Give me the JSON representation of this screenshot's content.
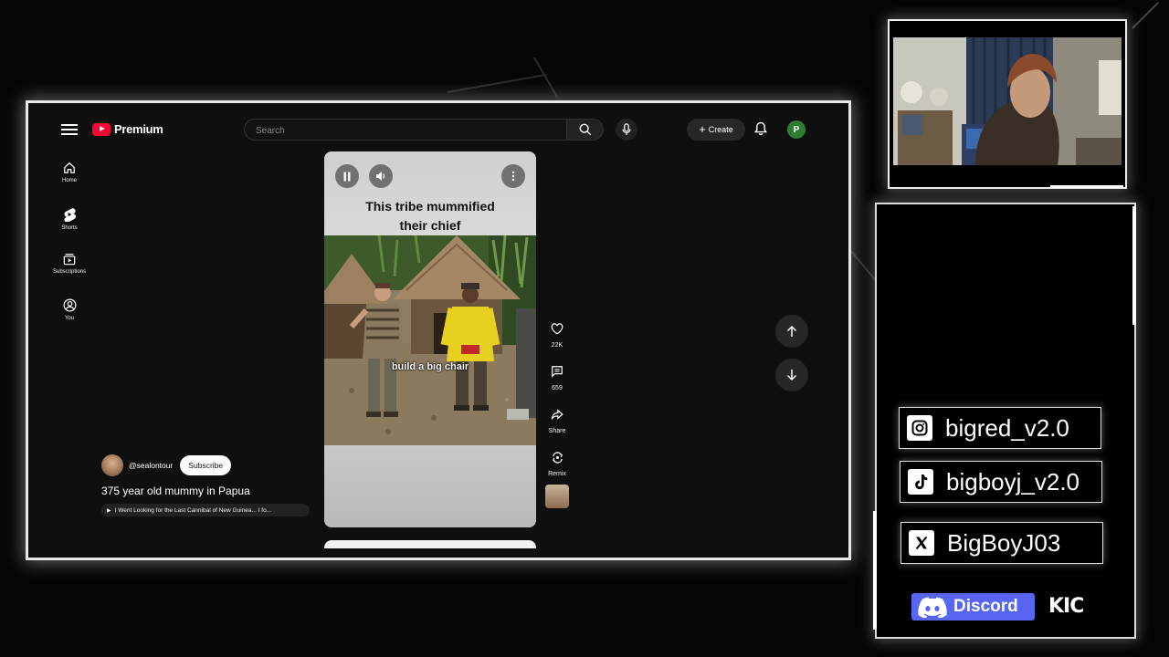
{
  "youtube": {
    "logo_text": "Premium",
    "search_placeholder": "Search",
    "create_label": "Create",
    "avatar_letter": "P",
    "nav": [
      {
        "label": "Home",
        "icon": "home-icon"
      },
      {
        "label": "Shorts",
        "icon": "shorts-icon"
      },
      {
        "label": "Subscriptions",
        "icon": "subscriptions-icon"
      },
      {
        "label": "You",
        "icon": "you-icon"
      }
    ]
  },
  "short": {
    "caption_line1": "This tribe mummified",
    "caption_line2": "their chief",
    "subtitle": "build a big chair",
    "actions": [
      {
        "label": "22K",
        "icon": "like-icon"
      },
      {
        "label": "659",
        "icon": "comment-icon"
      },
      {
        "label": "Share",
        "icon": "share-icon"
      },
      {
        "label": "Remix",
        "icon": "remix-icon"
      }
    ],
    "channel": "@sealontour",
    "subscribe_label": "Subscribe",
    "title": "375 year old mummy in Papua",
    "related": "I Went Looking for the Last Cannibal of New Guinea... I fo..."
  },
  "socials": [
    {
      "handle": "bigred_v2.0",
      "icon": "instagram-icon"
    },
    {
      "handle": "bigboyj_v2.0",
      "icon": "tiktok-icon"
    },
    {
      "handle": "BigBoyJ03",
      "icon": "x-icon"
    }
  ],
  "discord_label": "Discord",
  "kick_label": "KIC",
  "colors": {
    "youtube_red": "#ff0033",
    "discord": "#5865f2",
    "avatar_green": "#2e7d32",
    "background": "#0f0f0f"
  }
}
